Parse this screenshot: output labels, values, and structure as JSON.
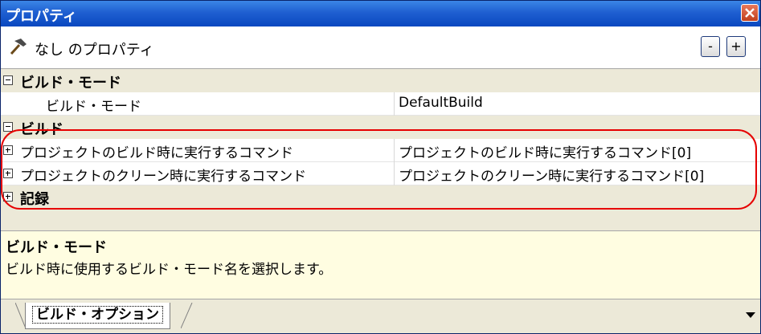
{
  "window": {
    "title": "プロパティ"
  },
  "toolbar": {
    "label": "なし のプロパティ",
    "collapse_label": "-",
    "expand_label": "+"
  },
  "grid": {
    "categories": [
      {
        "label": "ビルド・モード",
        "state": "expanded"
      },
      {
        "label": "ビルド",
        "state": "expanded"
      },
      {
        "label": "記録",
        "state": "collapsed"
      }
    ],
    "properties": [
      {
        "name": "ビルド・モード",
        "value": "DefaultBuild"
      },
      {
        "name": "プロジェクトのビルド時に実行するコマンド",
        "value": "プロジェクトのビルド時に実行するコマンド[0]"
      },
      {
        "name": "プロジェクトのクリーン時に実行するコマンド",
        "value": "プロジェクトのクリーン時に実行するコマンド[0]"
      }
    ]
  },
  "description": {
    "title": "ビルド・モード",
    "text": "ビルド時に使用するビルド・モード名を選択します。"
  },
  "tabs": [
    {
      "label": "ビルド・オプション",
      "active": true
    }
  ],
  "colors": {
    "titlebar": "#1f5fd1",
    "highlight": "#e60000",
    "description_bg": "#fffde1"
  }
}
